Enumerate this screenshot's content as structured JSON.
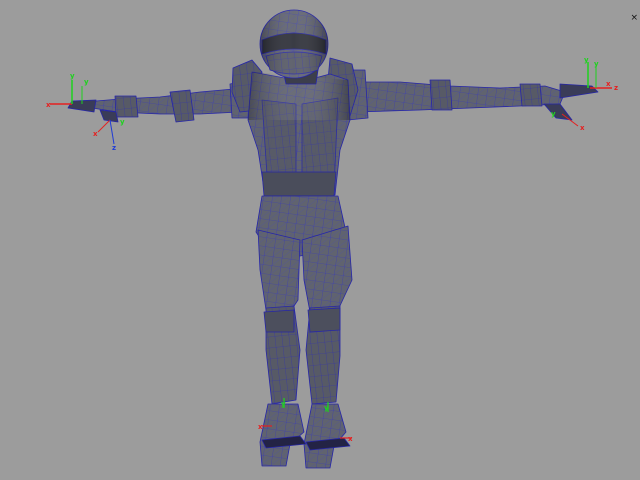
{
  "viewport": {
    "background": "#9c9c9c",
    "corner_glyph": "×"
  },
  "model": {
    "shading": "smooth-shade-with-wireframe-on-shaded",
    "pose": "t-pose",
    "mesh_color": "#60636f",
    "wire_color": "#2a2ab8",
    "dark_color": "#2d2f38"
  },
  "gizmos": {
    "x_color": "#e52020",
    "y_color": "#1fd11f",
    "z_color": "#1f3bd6",
    "x_label": "x",
    "y_label": "y",
    "z_label": "z"
  }
}
